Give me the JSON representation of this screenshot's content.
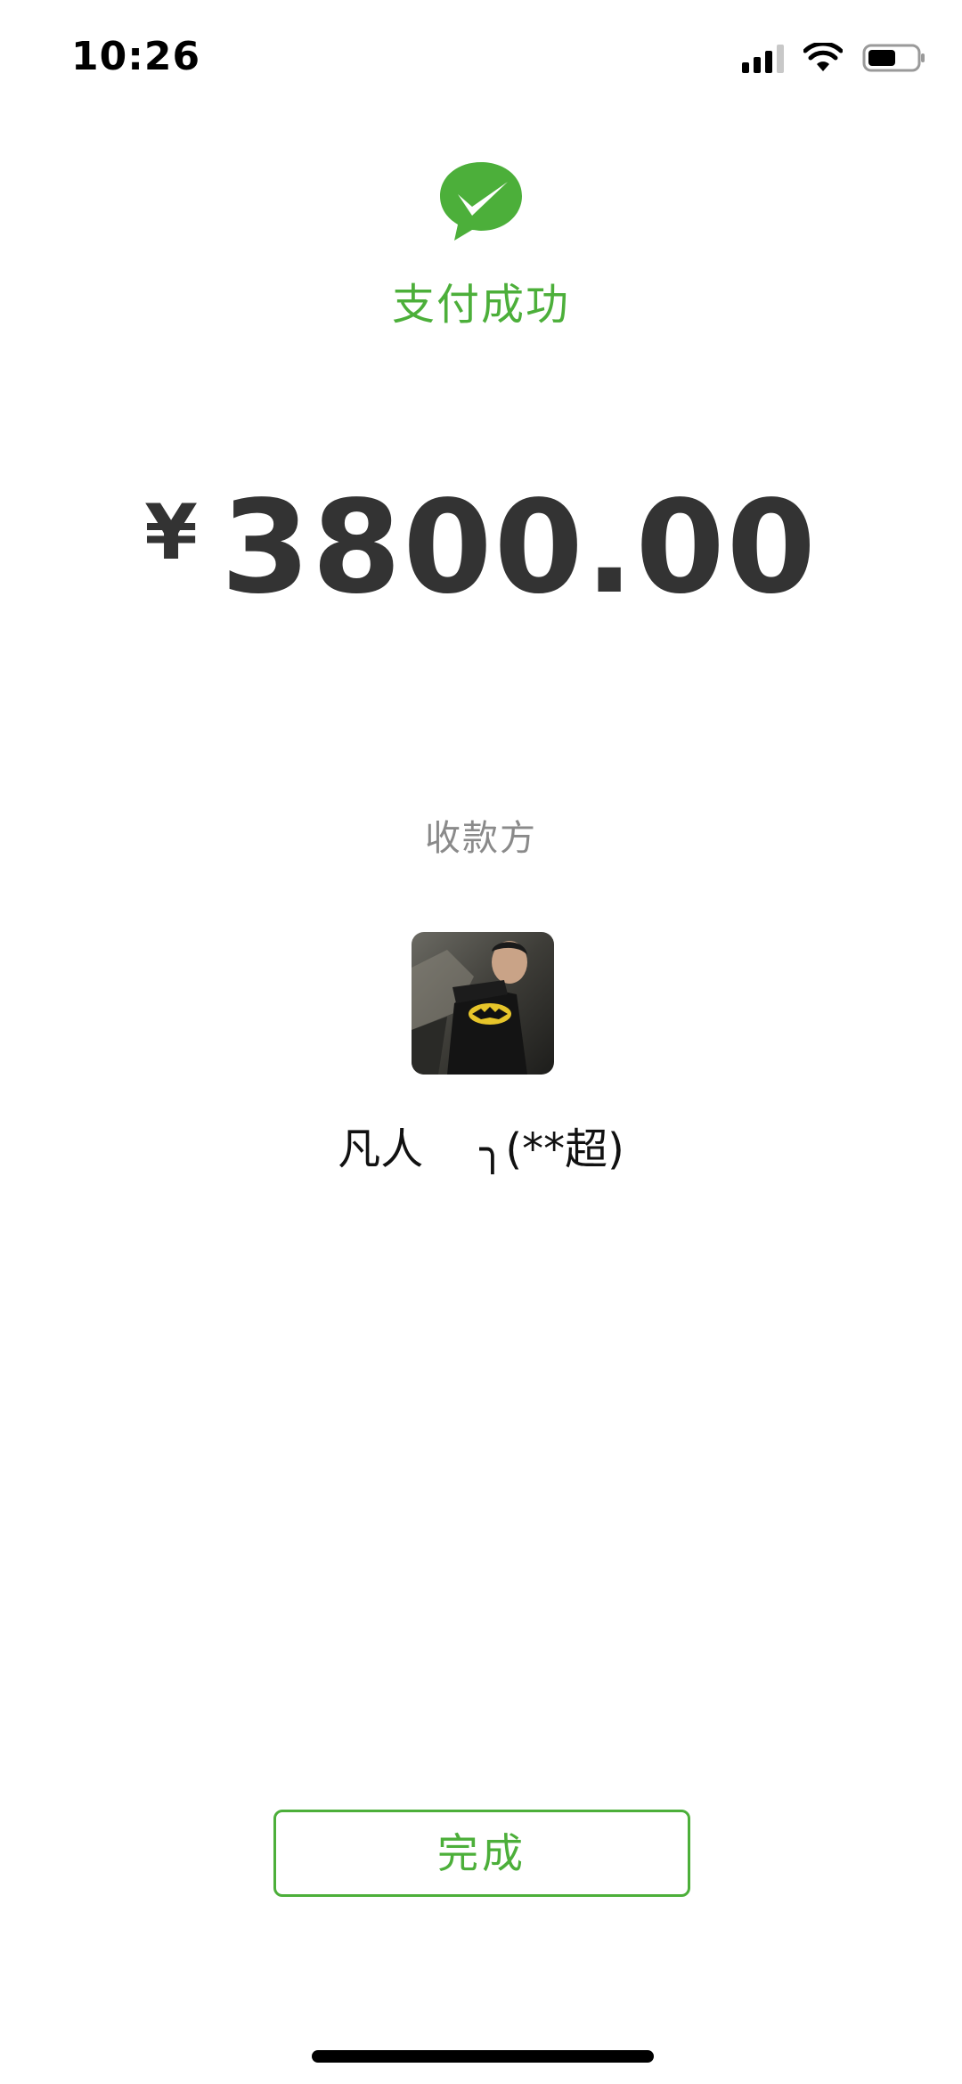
{
  "status_bar": {
    "time": "10:26",
    "icons": [
      "signal-icon",
      "wifi-icon",
      "battery-icon"
    ]
  },
  "payment": {
    "logo_icon": "wechat-pay-logo",
    "status_text": "支付成功",
    "currency_symbol": "¥",
    "amount": "3800.00"
  },
  "payee": {
    "label": "收款方",
    "avatar_icon": "payee-avatar-photo",
    "name": "凡人　 ╮(**超)"
  },
  "actions": {
    "done_label": "完成"
  },
  "colors": {
    "accent_green": "#4caf3a",
    "amount_text": "#333333",
    "secondary_text": "#8a8a8a"
  }
}
